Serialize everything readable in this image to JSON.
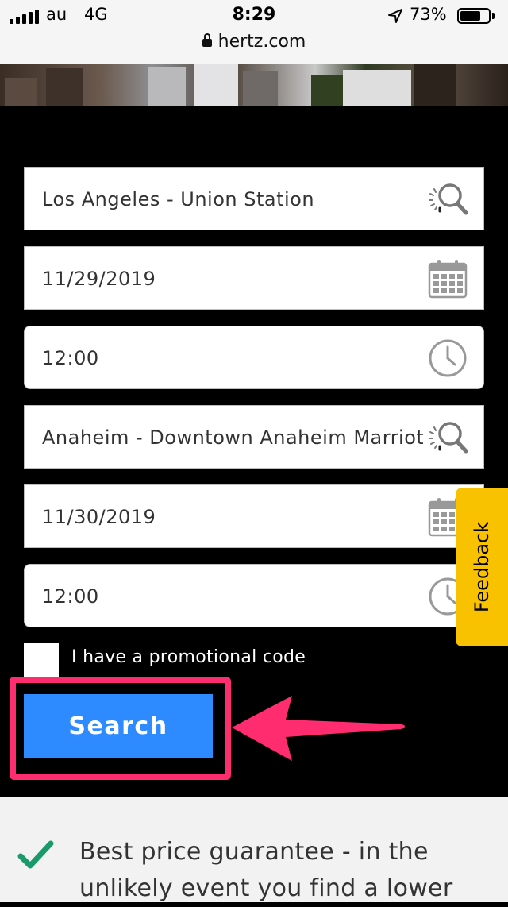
{
  "status_bar": {
    "carrier": "au",
    "network": "4G",
    "time": "8:29",
    "battery_percent": "73%",
    "battery_level": 0.73,
    "url": "hertz.com"
  },
  "form": {
    "pickup_location": "Los Angeles - Union Station",
    "pickup_date": "11/29/2019",
    "pickup_time": "12:00",
    "return_location": "Anaheim - Downtown Anaheim Marriott",
    "return_date": "11/30/2019",
    "return_time": "12:00",
    "promo_label": "I have a promotional code",
    "promo_checked": false,
    "search_label": "Search"
  },
  "feedback_label": "Feedback",
  "guarantee_text": "Best price guarantee - in the unlikely event you find a lower",
  "icons": {
    "location": "search-loading-icon",
    "date": "calendar-icon",
    "time": "clock-icon",
    "guarantee": "checkmark-icon"
  },
  "colors": {
    "accent": "#2e8bff",
    "highlight": "#ff2d6f",
    "feedback": "#f9c200",
    "check": "#1a9a6a"
  }
}
